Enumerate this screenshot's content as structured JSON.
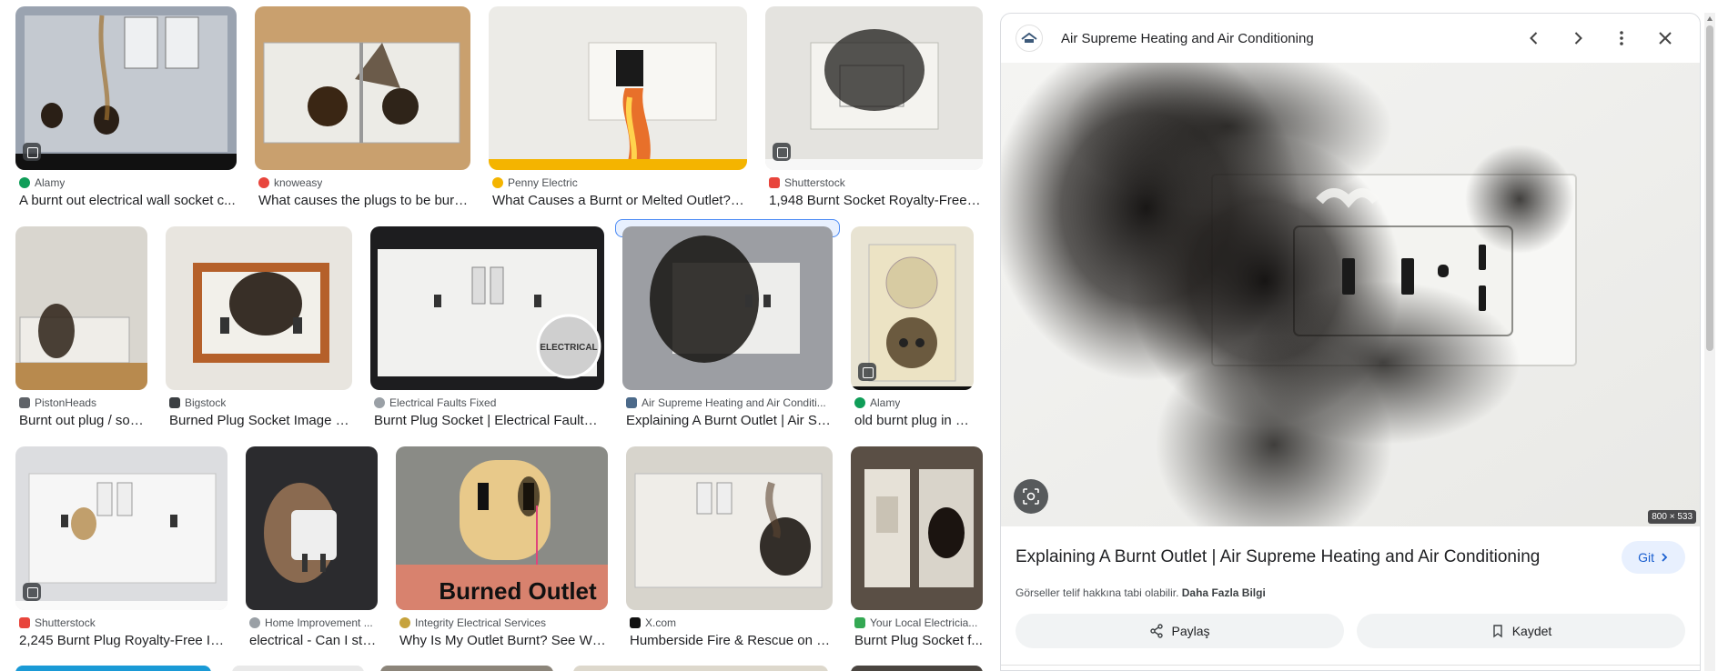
{
  "results": [
    {
      "source": "Alamy",
      "title": "A burnt out electrical wall socket c...",
      "favicon_color": "#0f9d58",
      "bg": "#9aa3b0"
    },
    {
      "source": "knoweasy",
      "title": "What causes the plugs to be burn...",
      "favicon_color": "#e8453c",
      "bg": "#c9a06e"
    },
    {
      "source": "Penny Electric",
      "title": "What Causes a Burnt or Melted Outlet? P...",
      "favicon_color": "#f4b400",
      "bg": "#e9e6e0"
    },
    {
      "source": "Shutterstock",
      "title": "1,948 Burnt Socket Royalty-Free I...",
      "favicon_color": "#e8453c",
      "bg": "#e4e3df"
    },
    {
      "source": "PistonHeads",
      "title": "Burnt out plug / soc...",
      "favicon_color": "#5f6368",
      "bg": "#b9b4aa"
    },
    {
      "source": "Bigstock",
      "title": "Burned Plug Socket Image & ...",
      "favicon_color": "#3c4043",
      "bg": "#cfc2ae"
    },
    {
      "source": "Electrical Faults Fixed",
      "title": "Burnt Plug Socket | Electrical Faults F...",
      "favicon_color": "#9aa0a6",
      "bg": "#1d1d1f"
    },
    {
      "source": "Air Supreme Heating and Air Conditi...",
      "title": "Explaining A Burnt Outlet | Air Su...",
      "favicon_color": "#4c6a8a",
      "bg": "#9c9ea3"
    },
    {
      "source": "Alamy",
      "title": "old burnt plug in a ...",
      "favicon_color": "#0f9d58",
      "bg": "#e8e3d2"
    },
    {
      "source": "Shutterstock",
      "title": "2,245 Burnt Plug Royalty-Free Im...",
      "favicon_color": "#e8453c",
      "bg": "#dcdde0"
    },
    {
      "source": "Home Improvement ...",
      "title": "electrical - Can I stil...",
      "favicon_color": "#9aa0a6",
      "bg": "#2b2b2e"
    },
    {
      "source": "Integrity Electrical Services",
      "title": "Why Is My Outlet Burnt? See Wha...",
      "favicon_color": "#c6a23c",
      "bg": "#8a8b86"
    },
    {
      "source": "X.com",
      "title": "Humberside Fire & Rescue on X: ...",
      "favicon_color": "#111111",
      "bg": "#d7d4cc"
    },
    {
      "source": "Your Local Electricia...",
      "title": "Burnt Plug Socket f...",
      "favicon_color": "#34a853",
      "bg": "#5a4f45"
    }
  ],
  "overlay_text": {
    "burned_outlet": "Burned Outlet",
    "stamp": "ELECTRICAL"
  },
  "panel": {
    "source": "Air Supreme Heating and Air Conditioning",
    "title": "Explaining A Burnt Outlet | Air Supreme Heating and Air Conditioning",
    "visit_label": "Git",
    "dimensions": "800 × 533",
    "copyright_text": "Görseller telif hakkına tabi olabilir.",
    "learn_more": "Daha Fazla Bilgi",
    "share_label": "Paylaş",
    "save_label": "Kaydet"
  },
  "icons": {
    "prev": "chevron-left-icon",
    "next": "chevron-right-icon",
    "more": "more-vert-icon",
    "close": "close-icon",
    "lens": "lens-icon",
    "share": "share-icon",
    "save": "bookmark-icon"
  }
}
